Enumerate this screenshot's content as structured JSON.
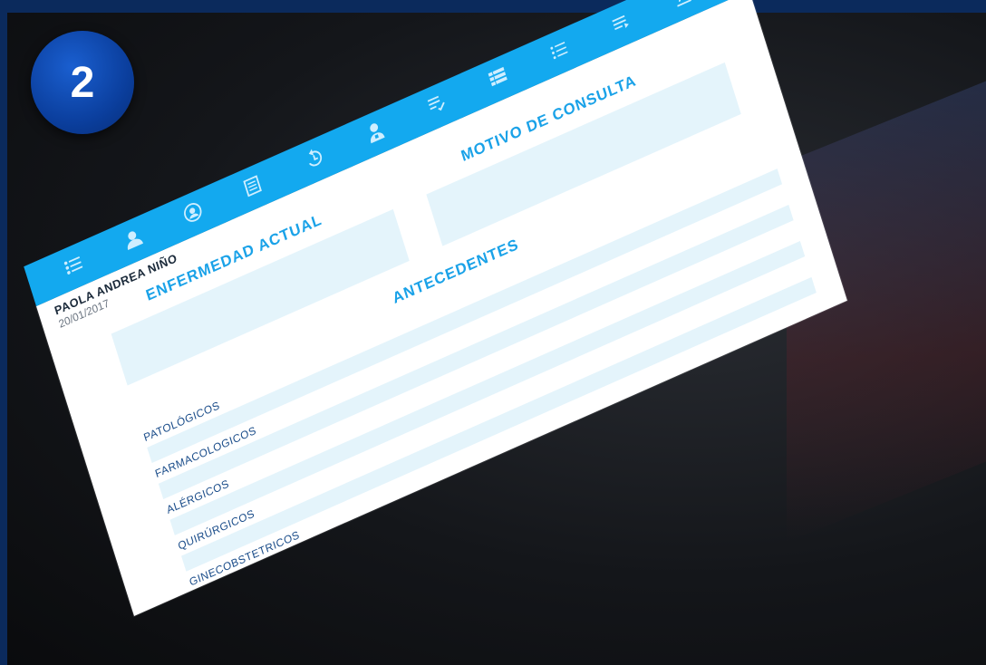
{
  "badge": {
    "number": "2"
  },
  "toolbar": {
    "icons": [
      "list-icon",
      "user-icon",
      "user-circle-icon",
      "document-icon",
      "history-icon",
      "doctor-icon",
      "prescription-icon",
      "table-icon",
      "list-bullets-icon",
      "list-lines-icon",
      "text-format-icon"
    ]
  },
  "patient": {
    "name": "PAOLA ANDREA NIÑO",
    "date": "20/01/2017"
  },
  "sections": {
    "enfermedad_actual": "ENFERMEDAD ACTUAL",
    "motivo_consulta": "MOTIVO DE CONSULTA",
    "antecedentes": "ANTECEDENTES"
  },
  "antecedentes_fields": [
    {
      "label": "PATOLÓGICOS",
      "value": ""
    },
    {
      "label": "FARMACOLOGICOS",
      "value": ""
    },
    {
      "label": "ALÉRGICOS",
      "value": ""
    },
    {
      "label": "QUIRÚRGICOS",
      "value": ""
    },
    {
      "label": "GINECOBSTETRICOS",
      "value": ""
    }
  ],
  "colors": {
    "accent": "#13a9ef",
    "badge": "#0b3f9e",
    "field_bg": "#e4f4fb",
    "label": "#1b4d8a"
  }
}
